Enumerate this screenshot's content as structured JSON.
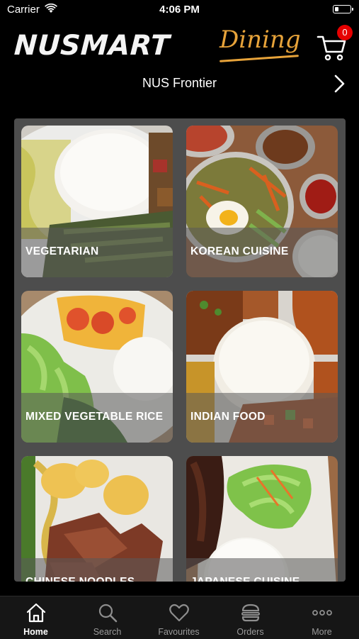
{
  "status_bar": {
    "carrier": "Carrier",
    "time": "4:06 PM"
  },
  "header": {
    "brand_main": "NUSMART",
    "brand_sub": "Dining",
    "cart_count": "0",
    "location": "NUS Frontier"
  },
  "categories": [
    {
      "label": "VEGETARIAN"
    },
    {
      "label": "KOREAN CUISINE"
    },
    {
      "label": "MIXED VEGETABLE RICE"
    },
    {
      "label": "INDIAN FOOD"
    },
    {
      "label": "CHINESE NOODLES"
    },
    {
      "label": "JAPANESE CUISINE"
    }
  ],
  "tabs": [
    {
      "label": "Home",
      "icon": "home-icon",
      "active": true
    },
    {
      "label": "Search",
      "icon": "search-icon",
      "active": false
    },
    {
      "label": "Favourites",
      "icon": "heart-icon",
      "active": false
    },
    {
      "label": "Orders",
      "icon": "burger-icon",
      "active": false
    },
    {
      "label": "More",
      "icon": "more-icon",
      "active": false
    }
  ],
  "colors": {
    "brand_accent": "#e7a33a",
    "badge": "#e60000",
    "panel": "#4d4d4d"
  }
}
